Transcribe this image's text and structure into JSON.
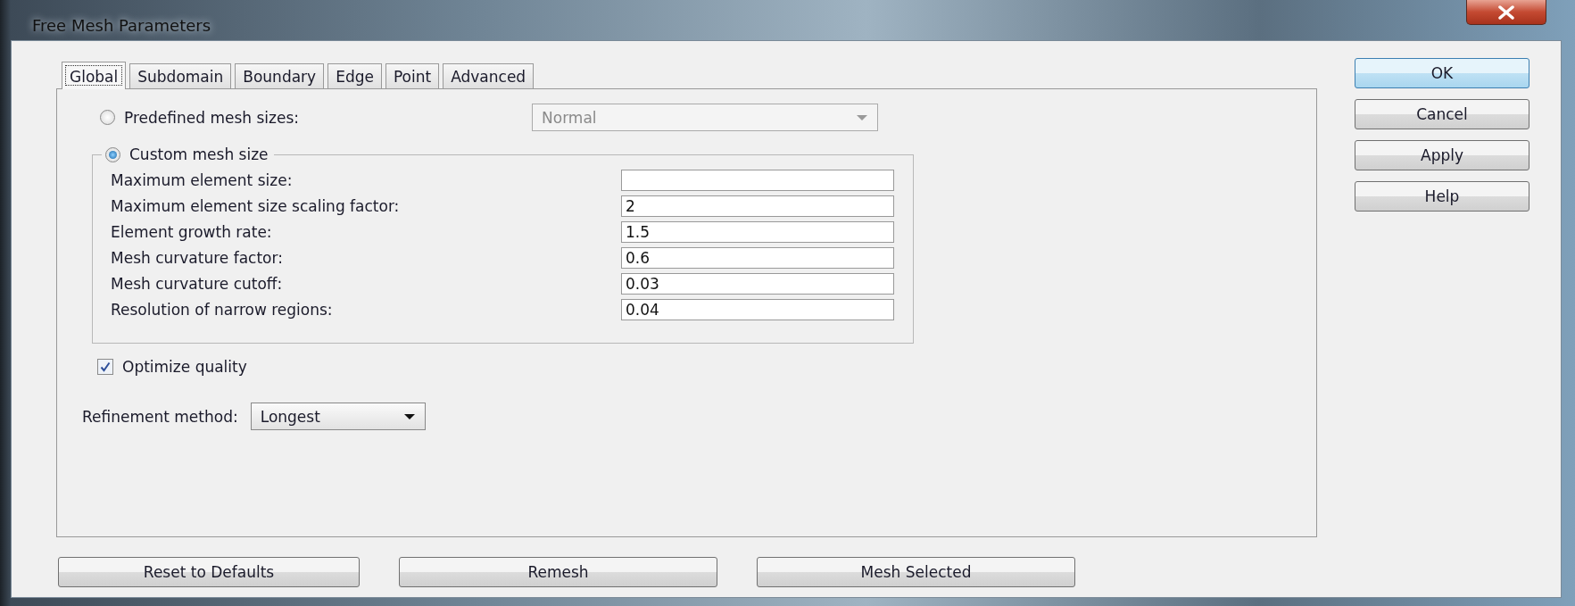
{
  "window": {
    "title": "Free Mesh Parameters"
  },
  "tabs": [
    {
      "label": "Global",
      "selected": true
    },
    {
      "label": "Subdomain",
      "selected": false
    },
    {
      "label": "Boundary",
      "selected": false
    },
    {
      "label": "Edge",
      "selected": false
    },
    {
      "label": "Point",
      "selected": false
    },
    {
      "label": "Advanced",
      "selected": false
    }
  ],
  "predefined": {
    "label": "Predefined mesh sizes:",
    "selected": false,
    "value": "Normal",
    "disabled": true
  },
  "custom": {
    "label": "Custom mesh size",
    "selected": true
  },
  "fields": [
    {
      "label": "Maximum element size:"
    },
    {
      "label": "Maximum element size scaling factor:",
      "value": "2"
    },
    {
      "label": "Element growth rate:",
      "value": "1.5"
    },
    {
      "label": "Mesh curvature factor:",
      "value": "0.6"
    },
    {
      "label": "Mesh curvature cutoff:",
      "value": "0.03"
    },
    {
      "label": "Resolution of narrow regions:",
      "value": "0.04"
    }
  ],
  "optimize": {
    "label": "Optimize quality",
    "checked": true
  },
  "refinement": {
    "label": "Refinement method:",
    "value": "Longest"
  },
  "side_buttons": [
    {
      "label": "OK",
      "default": true
    },
    {
      "label": "Cancel",
      "default": false
    },
    {
      "label": "Apply",
      "default": false
    },
    {
      "label": "Help",
      "default": false
    }
  ],
  "bottom_buttons": [
    "Reset to Defaults",
    "Remesh",
    "Mesh Selected"
  ]
}
